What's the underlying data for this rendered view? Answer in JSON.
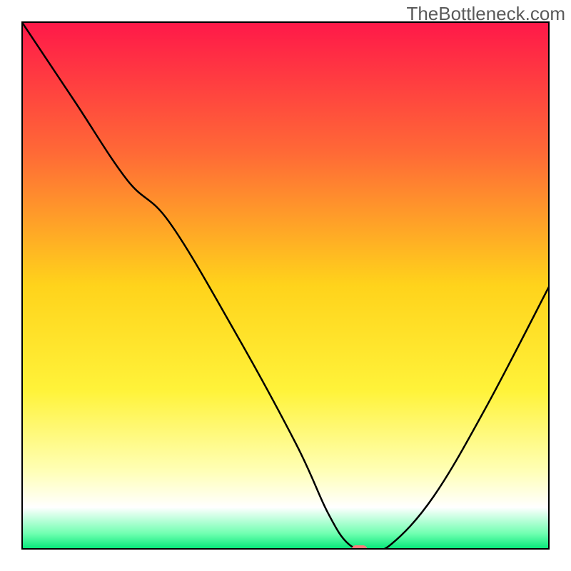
{
  "watermark": "TheBottleneck.com",
  "chart_data": {
    "type": "line",
    "title": "",
    "xlabel": "",
    "ylabel": "",
    "xlim": [
      0,
      100
    ],
    "ylim": [
      0,
      100
    ],
    "grid": false,
    "legend": false,
    "background": {
      "type": "vertical-gradient",
      "stops": [
        {
          "pos": 0,
          "color": "#ff1849"
        },
        {
          "pos": 25,
          "color": "#ff6a36"
        },
        {
          "pos": 50,
          "color": "#ffd31b"
        },
        {
          "pos": 70,
          "color": "#fff33a"
        },
        {
          "pos": 85,
          "color": "#ffffb5"
        },
        {
          "pos": 92,
          "color": "#ffffff"
        },
        {
          "pos": 97,
          "color": "#6fffb0"
        },
        {
          "pos": 100,
          "color": "#00e676"
        }
      ]
    },
    "series": [
      {
        "name": "bottleneck-curve",
        "x": [
          0,
          10,
          20,
          28,
          40,
          52,
          58,
          62,
          66,
          70,
          78,
          88,
          100
        ],
        "values": [
          100,
          85,
          70,
          62,
          42,
          20,
          7,
          1,
          0,
          1,
          10,
          27,
          50
        ]
      }
    ],
    "marker": {
      "name": "optimal-point",
      "x": 64,
      "y": 0,
      "color": "#ff7a7a"
    }
  }
}
